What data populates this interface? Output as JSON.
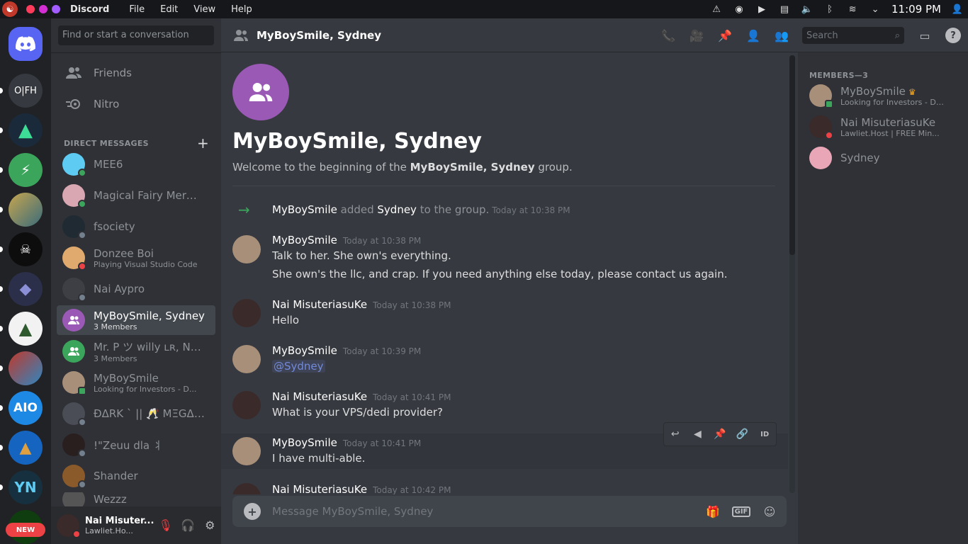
{
  "system_bar": {
    "app_name": "Discord",
    "menus": [
      "File",
      "Edit",
      "View",
      "Help"
    ],
    "clock": "11:09 PM"
  },
  "guild_bar": {
    "new_badge": "NEW",
    "items": [
      {
        "label": "",
        "color": "#5865f2"
      },
      {
        "label": "O|FH",
        "color": "#36393f"
      },
      {
        "label": "",
        "color": "#1a2a3a"
      },
      {
        "label": "",
        "color": "#3ba55c"
      },
      {
        "label": "",
        "color": "#8a6d3b"
      },
      {
        "label": "",
        "color": "#0d0d0d"
      },
      {
        "label": "",
        "color": "#2c2f4a"
      },
      {
        "label": "",
        "color": "#f2f2f2"
      },
      {
        "label": "",
        "color": "#c0392b"
      },
      {
        "label": "AIO",
        "color": "#1e88e5"
      },
      {
        "label": "",
        "color": "#1565c0"
      },
      {
        "label": "YN",
        "color": "#17303f"
      },
      {
        "label": "",
        "color": "#0f3d0f"
      }
    ]
  },
  "dm_sidebar": {
    "search_placeholder": "Find or start a conversation",
    "friends_label": "Friends",
    "nitro_label": "Nitro",
    "dm_header": "DIRECT MESSAGES",
    "dms": [
      {
        "name": "MEE6",
        "sub": "",
        "avatar_color": "#5ecbf2",
        "status_color": "#3ba55c"
      },
      {
        "name": "Magical Fairy Mermaid",
        "sub": "",
        "avatar_color": "#d8a7b1",
        "status_color": "#3ba55c"
      },
      {
        "name": "fsociety",
        "sub": "",
        "avatar_color": "#1f2a33",
        "status_color": "#747f8d"
      },
      {
        "name": "Donzee Boi",
        "sub": "Playing Visual Studio Code",
        "avatar_color": "#e0a96d",
        "status_color": "#ed4245"
      },
      {
        "name": "Nai Aypro",
        "sub": "",
        "avatar_color": "#3d3f45",
        "status_color": "#747f8d"
      },
      {
        "name": "MyBoySmile, Sydney",
        "sub": "3 Members",
        "avatar_color": "#9b59b6",
        "status_color": ""
      },
      {
        "name": "Mr. P ツ willy ʟʀ, Nai ...",
        "sub": "3 Members",
        "avatar_color": "#3ba55c",
        "status_color": ""
      },
      {
        "name": "MyBoySmile",
        "sub": "Looking for Investors - D...",
        "avatar_color": "#a88f7a",
        "status_color": "#3ba55c"
      },
      {
        "name": "ĐΔRK ` || 🥂 ΜΞGΔ ...",
        "sub": "",
        "avatar_color": "#4a4d55",
        "status_color": "#747f8d"
      },
      {
        "name": "!\"Zeuu dla ⺦",
        "sub": "",
        "avatar_color": "#2a1f1f",
        "status_color": "#747f8d"
      },
      {
        "name": "Shander",
        "sub": "",
        "avatar_color": "#8b5a2b",
        "status_color": "#747f8d"
      },
      {
        "name": "Wezzz",
        "sub": "",
        "avatar_color": "#555",
        "status_color": ""
      }
    ]
  },
  "user_panel": {
    "name": "Nai Misuter...",
    "status": "Lawliet.Ho..."
  },
  "channel": {
    "title": "MyBoySmile, Sydney",
    "search_placeholder": "Search",
    "welcome_title": "MyBoySmile, Sydney",
    "welcome_prefix": "Welcome to the beginning of the ",
    "welcome_name": "MyBoySmile, Sydney",
    "welcome_suffix": " group.",
    "system_message": {
      "actor": "MyBoySmile",
      "verb": " added ",
      "target": "Sydney",
      "rest": " to the group.",
      "time": "Today at 10:38 PM"
    },
    "messages": [
      {
        "author": "MyBoySmile",
        "time": "Today at 10:38 PM",
        "lines": [
          "Talk to her. She own's everything.",
          "She own's the llc, and crap. If you need anything else today, please contact us again."
        ],
        "avatar_color": "#a88f7a"
      },
      {
        "author": "Nai MisuteriasuKe",
        "time": "Today at 10:38 PM",
        "lines": [
          "Hello"
        ],
        "avatar_color": "#3a2a2a"
      },
      {
        "author": "MyBoySmile",
        "time": "Today at 10:39 PM",
        "lines": [
          "@Sydney"
        ],
        "avatar_color": "#a88f7a"
      },
      {
        "author": "Nai MisuteriasuKe",
        "time": "Today at 10:41 PM",
        "lines": [
          "What is your VPS/dedi provider?"
        ],
        "avatar_color": "#3a2a2a"
      },
      {
        "author": "MyBoySmile",
        "time": "Today at 10:41 PM",
        "lines": [
          "I have multi-able."
        ],
        "avatar_color": "#a88f7a"
      },
      {
        "author": "Nai MisuteriasuKe",
        "time": "Today at 10:42 PM",
        "lines": [
          ""
        ],
        "avatar_color": "#3a2a2a"
      }
    ],
    "composer_placeholder": "Message MyBoySmile, Sydney",
    "gif_label": "GIF"
  },
  "members": {
    "header": "MEMBERS—3",
    "list": [
      {
        "name": "MyBoySmile",
        "sub": "Looking for Investors - Dm ...",
        "avatar_color": "#a88f7a",
        "status_color": "#3ba55c"
      },
      {
        "name": "Nai MisuteriasuKe",
        "sub": "Lawliet.Host | FREE Min...",
        "avatar_color": "#3a2a2a",
        "status_color": "#ed4245"
      },
      {
        "name": "Sydney",
        "sub": "",
        "avatar_color": "#e8a6b6",
        "status_color": ""
      }
    ]
  }
}
